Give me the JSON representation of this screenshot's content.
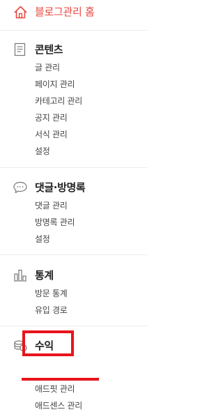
{
  "home": {
    "label": "블로그관리 홈",
    "icon": "home-icon",
    "color": "#e8473f"
  },
  "sections": [
    {
      "title": "콘텐츠",
      "icon": "document-icon",
      "items": [
        "글 관리",
        "페이지 관리",
        "카테고리 관리",
        "공지 관리",
        "서식 관리",
        "설정"
      ]
    },
    {
      "title": "댓글·방명록",
      "icon": "speech-bubble-icon",
      "items": [
        "댓글 관리",
        "방명록 관리",
        "설정"
      ]
    },
    {
      "title": "통계",
      "icon": "bar-chart-icon",
      "items": [
        "방문 통계",
        "유입 경로"
      ]
    },
    {
      "title": "수익",
      "icon": "coins-icon",
      "items": [
        "애드핏 관리",
        "애드센스 관리"
      ]
    }
  ],
  "annotations": {
    "highlight_color": "#e8141c"
  }
}
